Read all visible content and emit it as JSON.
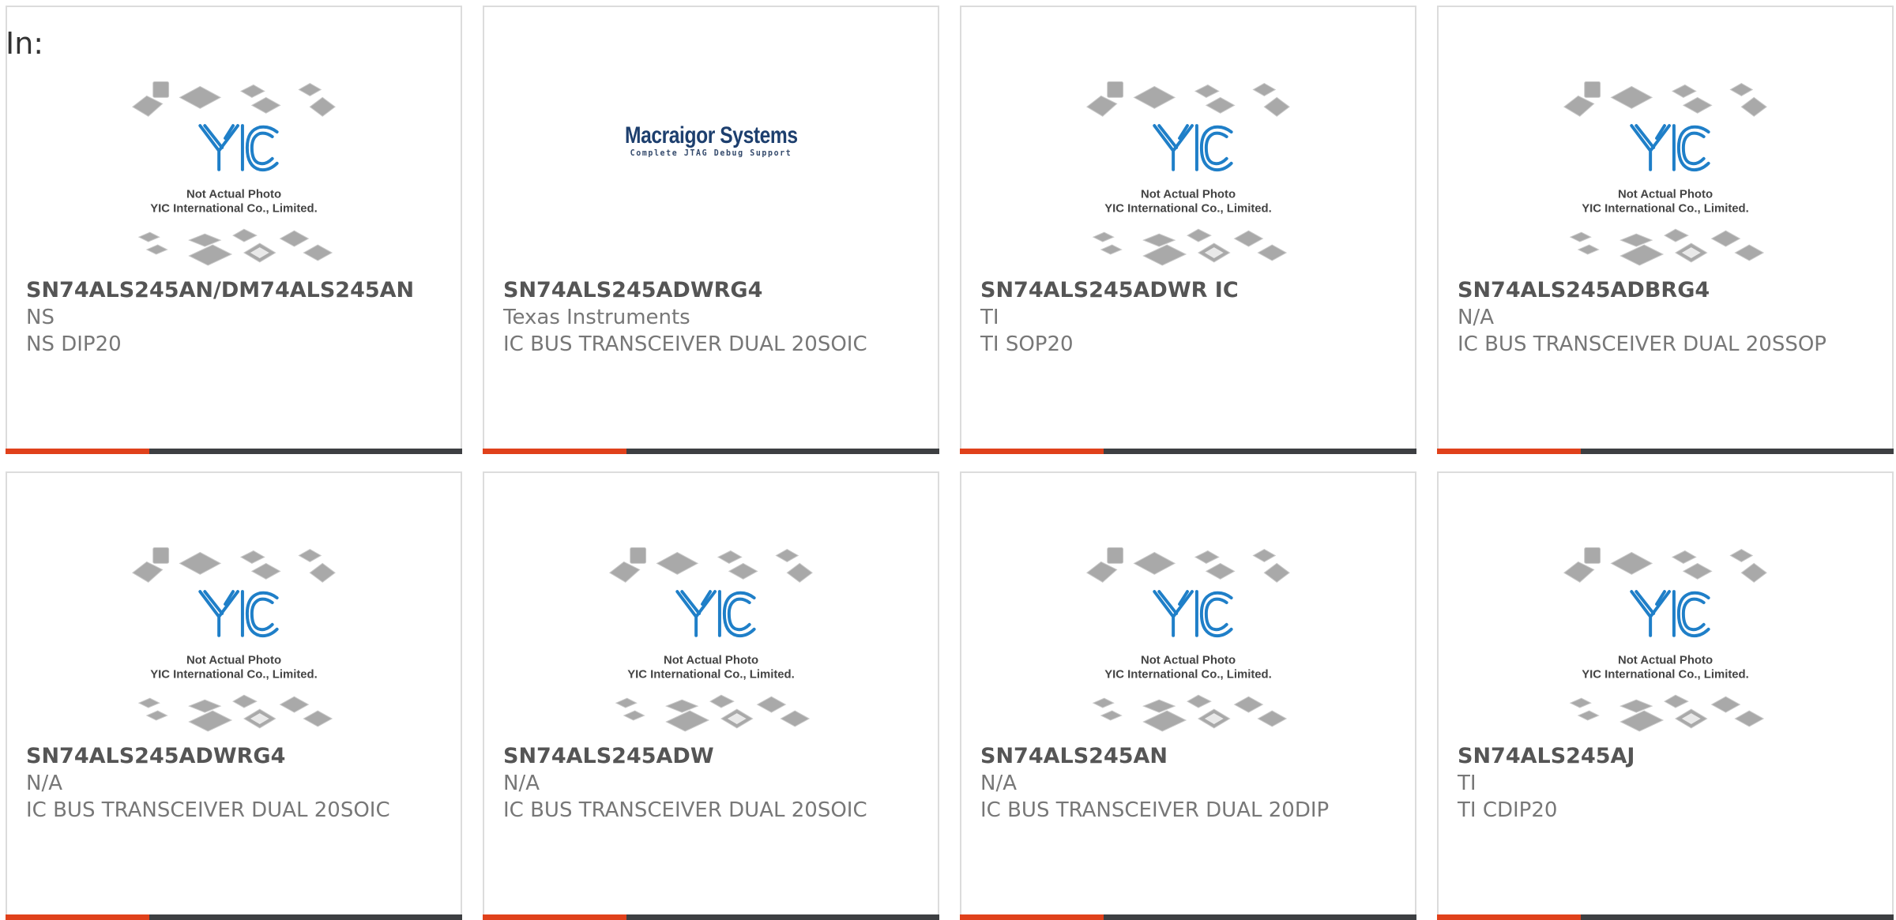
{
  "page": {
    "label": "In:"
  },
  "theme": {
    "accent": "#e0411b",
    "bar": "#3d3f42",
    "logo_blue": "#1f7fc8"
  },
  "photo_placeholder": {
    "line1": "Not Actual Photo",
    "line2": "YIC International Co., Limited.",
    "logo_text": "YIC"
  },
  "macraigor": {
    "title": "Macraigor Systems",
    "subtitle": "Complete JTAG Debug Support"
  },
  "products": [
    {
      "part": "SN74ALS245AN/DM74ALS245AN",
      "manufacturer": "NS",
      "description": "NS DIP20",
      "image": "yic-placeholder"
    },
    {
      "part": "SN74ALS245ADWRG4",
      "manufacturer": "Texas Instruments",
      "description": "IC BUS TRANSCEIVER DUAL 20SOIC",
      "image": "macraigor-logo"
    },
    {
      "part": "SN74ALS245ADWR IC",
      "manufacturer": "TI",
      "description": "TI SOP20",
      "image": "yic-placeholder"
    },
    {
      "part": "SN74ALS245ADBRG4",
      "manufacturer": "N/A",
      "description": "IC BUS TRANSCEIVER DUAL 20SSOP",
      "image": "yic-placeholder"
    },
    {
      "part": "SN74ALS245ADWRG4",
      "manufacturer": "N/A",
      "description": "IC BUS TRANSCEIVER DUAL 20SOIC",
      "image": "yic-placeholder"
    },
    {
      "part": "SN74ALS245ADW",
      "manufacturer": "N/A",
      "description": "IC BUS TRANSCEIVER DUAL 20SOIC",
      "image": "yic-placeholder"
    },
    {
      "part": "SN74ALS245AN",
      "manufacturer": "N/A",
      "description": "IC BUS TRANSCEIVER DUAL 20DIP",
      "image": "yic-placeholder"
    },
    {
      "part": "SN74ALS245AJ",
      "manufacturer": "TI",
      "description": "TI CDIP20",
      "image": "yic-placeholder"
    }
  ]
}
